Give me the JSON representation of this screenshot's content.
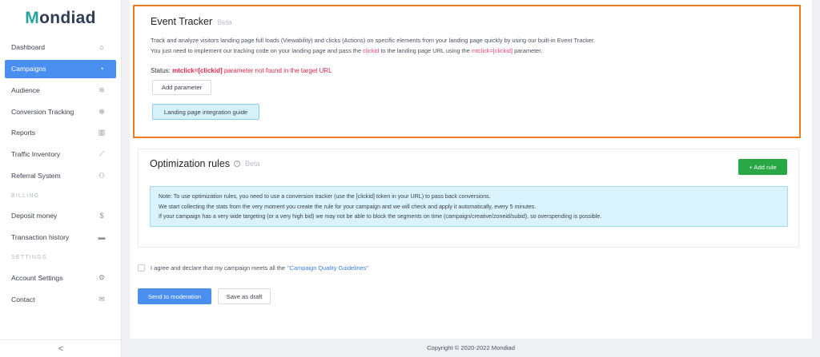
{
  "brand": {
    "logo_first": "M",
    "logo_rest": "ondiad"
  },
  "sidebar": {
    "items": [
      {
        "label": "Dashboard",
        "icon": "home-icon",
        "glyph": "⌂"
      },
      {
        "label": "Campaigns",
        "icon": "pie-chart-icon",
        "glyph": "◔",
        "active": true
      },
      {
        "label": "Audience",
        "icon": "layers-icon",
        "glyph": "≋"
      },
      {
        "label": "Conversion Tracking",
        "icon": "globe-icon",
        "glyph": "⊕"
      },
      {
        "label": "Reports",
        "icon": "bar-chart-icon",
        "glyph": "▥"
      },
      {
        "label": "Traffic Inventory",
        "icon": "line-chart-icon",
        "glyph": "⟋"
      },
      {
        "label": "Referral System",
        "icon": "users-icon",
        "glyph": "⚇"
      }
    ],
    "billing_label": "BILLING",
    "billing_items": [
      {
        "label": "Deposit money",
        "icon": "dollar-icon",
        "glyph": "$"
      },
      {
        "label": "Transaction history",
        "icon": "wallet-icon",
        "glyph": "▬"
      }
    ],
    "settings_label": "SETTINGS",
    "settings_items": [
      {
        "label": "Account Settings",
        "icon": "gears-icon",
        "glyph": "⚙"
      },
      {
        "label": "Contact",
        "icon": "envelope-icon",
        "glyph": "✉"
      }
    ],
    "collapse_glyph": "<"
  },
  "event_tracker": {
    "title": "Event Tracker",
    "beta": "Beta",
    "desc_line1": "Track and analyze visitors landing page full loads (Viewability) and clicks (Actions) on specific elements from your landing page quickly by using our built-in Event Tracker.",
    "desc_line2_a": "You just need to implement our tracking code on your landing page and pass the ",
    "desc_line2_clickid": "clickid",
    "desc_line2_b": " to the landing page URL using the ",
    "desc_line2_param": "mtclick=[clickid]",
    "desc_line2_c": " parameter.",
    "status_label": "Status:",
    "status_param": "mtclick=[clickid]",
    "status_msg": "parameter not found in the target URL",
    "add_parameter": "Add parameter",
    "guide_button": "Landing page integration guide"
  },
  "optimization": {
    "title": "Optimization rules",
    "beta": "Beta",
    "add_rule": "+ Add rule",
    "note_line1": "Note: To use optimization rules, you need to use a conversion tracker (use the [clickid] token in your URL) to pass back conversions.",
    "note_line2": "We start collecting the stats from the very moment you create the rule for your campaign and we will check and apply it automatically, every 5 minutes.",
    "note_line3": "If your campaign has a very wide targeting (or a very high bid) we may not be able to block the segments on time (campaign/creative/zoneid/subid), so overspending is possible."
  },
  "agreement": {
    "text": "I agree and declare that my campaign meets all the",
    "link": "\"Campaign Quality Guidelines\""
  },
  "actions": {
    "send": "Send to moderation",
    "draft": "Save as draft"
  },
  "footer": {
    "copyright": "Copyright © 2020-2022 Mondiad"
  },
  "colors": {
    "accent": "#4a8ff0",
    "highlight_border": "#f07a22",
    "success": "#28a745",
    "error": "#e2264a",
    "teal": "#27a3a1"
  }
}
